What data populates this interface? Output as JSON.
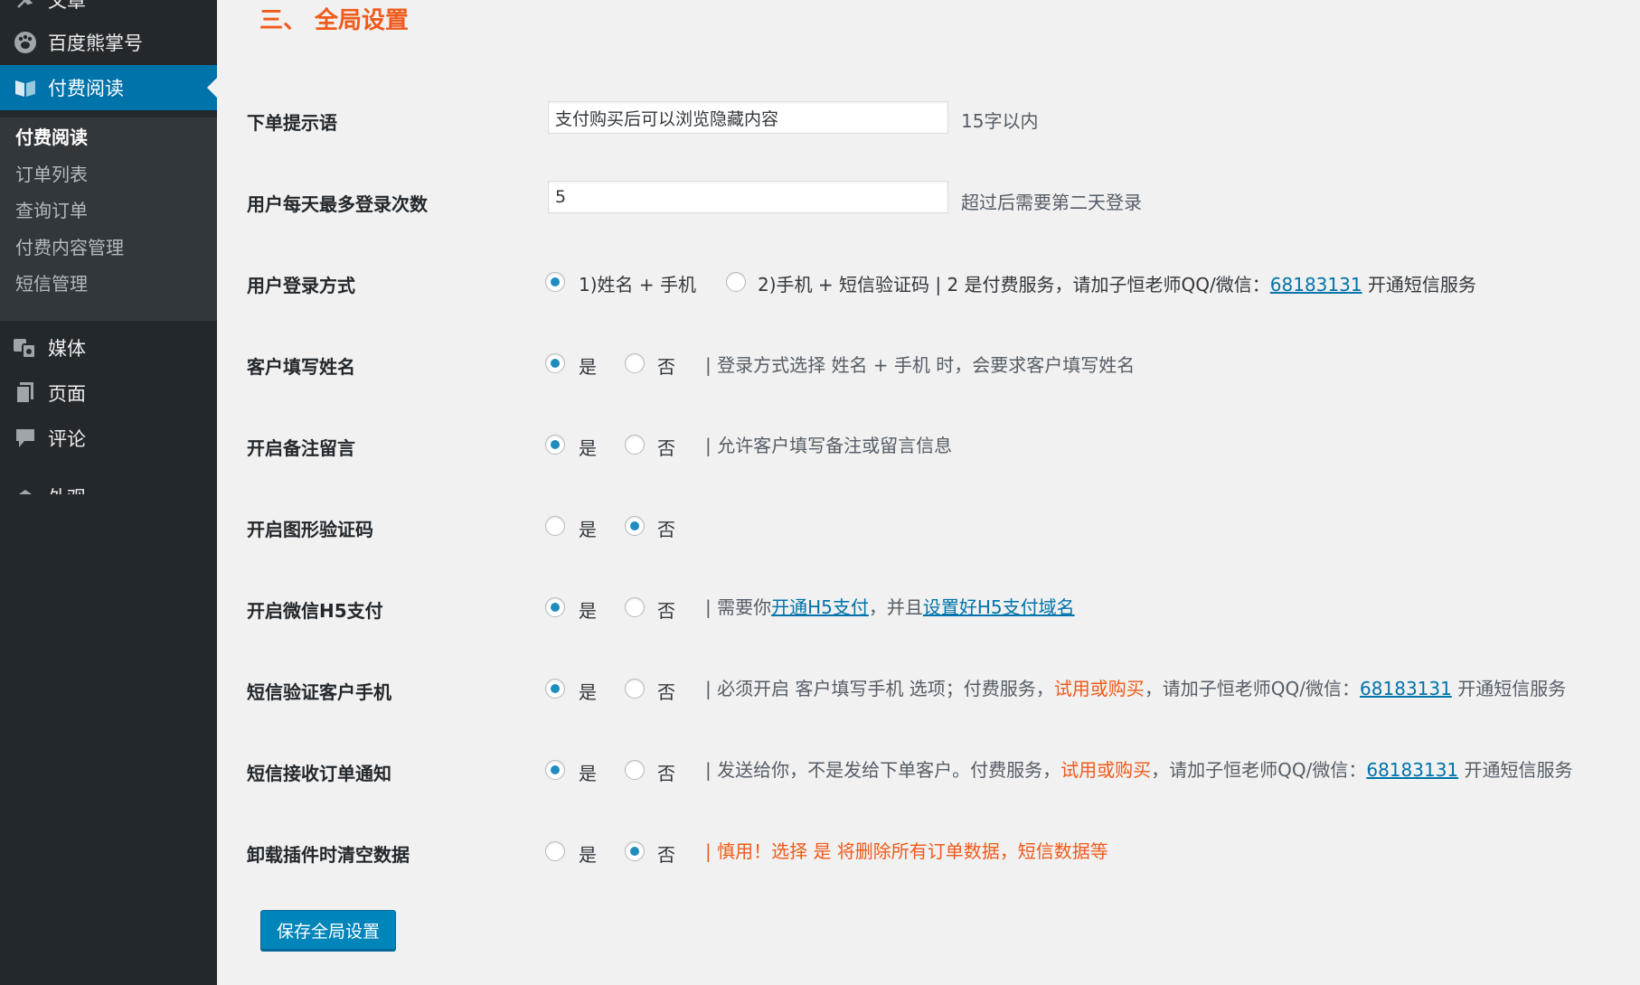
{
  "sidebar": {
    "items": [
      {
        "label": "文章",
        "icon": "pin-icon"
      },
      {
        "label": "百度熊掌号",
        "icon": "paw-icon"
      },
      {
        "label": "付费阅读",
        "icon": "book-icon"
      },
      {
        "label": "媒体",
        "icon": "media-icon"
      },
      {
        "label": "页面",
        "icon": "page-icon"
      },
      {
        "label": "评论",
        "icon": "comment-icon"
      },
      {
        "label": "外观",
        "icon": "brush-icon"
      }
    ],
    "submenu": [
      "付费阅读",
      "订单列表",
      "查询订单",
      "付费内容管理",
      "短信管理"
    ]
  },
  "main": {
    "section_title": "三、 全局设置",
    "order_prompt": {
      "label": "下单提示语",
      "value": "支付购买后可以浏览隐藏内容",
      "hint": "15字以内"
    },
    "max_logins": {
      "label": "用户每天最多登录次数",
      "value": "5",
      "hint": "超过后需要第二天登录"
    },
    "login_method": {
      "label": "用户登录方式",
      "option1": "1)姓名 + 手机",
      "option2": "2)手机 + 短信验证码 | 2 是付费服务，请加子恒老师QQ/微信：",
      "qq": "68183131",
      "suffix": "开通短信服务"
    },
    "yes_label": "是",
    "no_label": "否",
    "customer_name": {
      "label": "客户填写姓名",
      "desc": "| 登录方式选择 姓名 + 手机 时，会要求客户填写姓名"
    },
    "remarks": {
      "label": "开启备注留言",
      "desc": "| 允许客户填写备注或留言信息"
    },
    "captcha": {
      "label": "开启图形验证码"
    },
    "wechat_h5": {
      "label": "开启微信H5支付",
      "desc_prefix": "| 需要你",
      "link1": "开通H5支付",
      "desc_mid": "，并且",
      "link2": "设置好H5支付域名"
    },
    "sms_verify": {
      "label": "短信验证客户手机",
      "desc_prefix": "| 必须开启 客户填写手机 选项；付费服务，",
      "trial": "试用或购买",
      "desc_mid": "，请加子恒老师QQ/微信：",
      "qq": "68183131",
      "suffix": "开通短信服务"
    },
    "sms_notify": {
      "label": "短信接收订单通知",
      "desc_prefix": "| 发送给你，不是发给下单客户。付费服务，",
      "trial": "试用或购买",
      "desc_mid": "，请加子恒老师QQ/微信：",
      "qq": "68183131",
      "suffix": "开通短信服务"
    },
    "uninstall": {
      "label": "卸载插件时清空数据",
      "desc": "| 慎用！选择 是 将删除所有订单数据，短信数据等"
    },
    "save_button": "保存全局设置"
  },
  "colors": {
    "sidebar_bg": "#23282d",
    "submenu_bg": "#32373c",
    "active_menu": "#0073aa",
    "title_orange": "#f05a1a",
    "link_blue": "#0073aa",
    "radio_dot": "#1e8cbe",
    "button_blue": "#0085ba"
  }
}
